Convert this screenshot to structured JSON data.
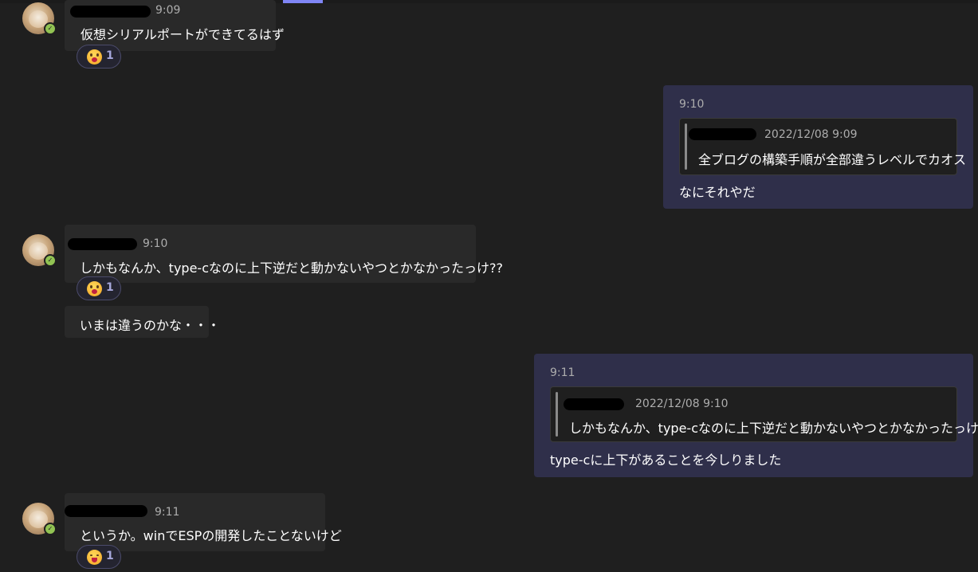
{
  "messages": [
    {
      "time": "9:09",
      "text": "仮想シリアルポートができてるはず",
      "reaction_count": "1"
    },
    {
      "time": "9:10",
      "quote_time": "2022/12/08 9:09",
      "quote_text": "全ブログの構築手順が全部違うレベルでカオス",
      "text": "なにそれやだ"
    },
    {
      "time": "9:10",
      "text": "しかもなんか、type-cなのに上下逆だと動かないやつとかなかったっけ??",
      "reaction_count": "1",
      "followup": "いまは違うのかな・・・"
    },
    {
      "time": "9:11",
      "quote_time": "2022/12/08 9:10",
      "quote_text": "しかもなんか、type-cなのに上下逆だと動かないやつとかなかったっけ??",
      "text": "type-cに上下があることを今しりました"
    },
    {
      "time": "9:11",
      "text": "というか。winでESPの開発したことないけど",
      "reaction_count": "1"
    }
  ],
  "colors": {
    "background": "#1f1f1f",
    "bubble_other": "#292929",
    "bubble_mine": "#2f2f4a",
    "accent": "#7f85f5",
    "presence": "#92c353"
  },
  "icons": {
    "presence": "check-icon",
    "reaction_surprised": "surprised-emoji-icon",
    "reaction_laugh": "laughing-emoji-icon"
  }
}
